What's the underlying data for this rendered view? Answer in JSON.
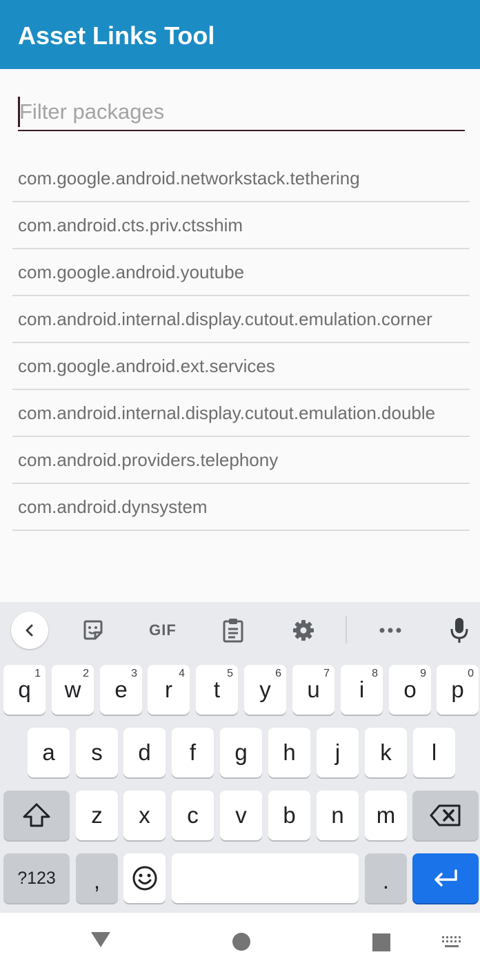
{
  "app": {
    "title": "Asset Links Tool"
  },
  "filter": {
    "placeholder": "Filter packages",
    "value": ""
  },
  "packages": [
    "com.google.android.networkstack.tethering",
    "com.android.cts.priv.ctsshim",
    "com.google.android.youtube",
    "com.android.internal.display.cutout.emulation.corner",
    "com.google.android.ext.services",
    "com.android.internal.display.cutout.emulation.double",
    "com.android.providers.telephony",
    "com.android.dynsystem"
  ],
  "keyboard": {
    "toolbar": [
      "back-chevron-icon",
      "sticker-icon",
      "gif-label",
      "clipboard-icon",
      "gear-icon",
      "more-icon",
      "microphone-icon"
    ],
    "gif_label": "GIF",
    "row1": [
      {
        "k": "q",
        "h": "1"
      },
      {
        "k": "w",
        "h": "2"
      },
      {
        "k": "e",
        "h": "3"
      },
      {
        "k": "r",
        "h": "4"
      },
      {
        "k": "t",
        "h": "5"
      },
      {
        "k": "y",
        "h": "6"
      },
      {
        "k": "u",
        "h": "7"
      },
      {
        "k": "i",
        "h": "8"
      },
      {
        "k": "o",
        "h": "9"
      },
      {
        "k": "p",
        "h": "0"
      }
    ],
    "row2": [
      "a",
      "s",
      "d",
      "f",
      "g",
      "h",
      "j",
      "k",
      "l"
    ],
    "row3": [
      "z",
      "x",
      "c",
      "v",
      "b",
      "n",
      "m"
    ],
    "symbols_label": "?123",
    "comma": ",",
    "period": ".",
    "accent_color": "#1a73e8"
  },
  "navbar": {
    "icons": [
      "back-triangle-icon",
      "home-circle-icon",
      "recents-square-icon",
      "keyboard-switch-icon"
    ]
  }
}
